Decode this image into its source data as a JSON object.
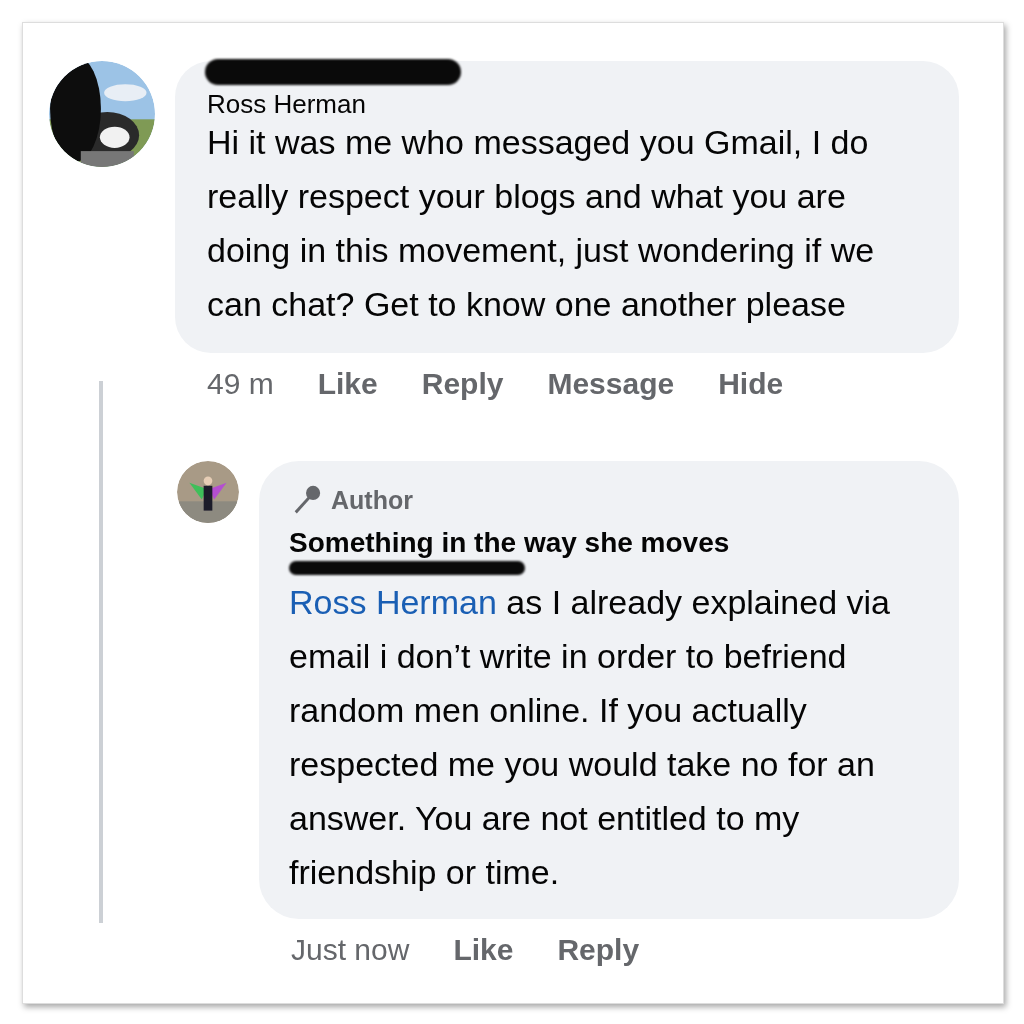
{
  "comments": [
    {
      "author": "Ross Herman",
      "redacted": true,
      "text": "Hi it was me who messaged you Gmail, I do really respect your blogs and what you are doing in this movement, just wondering if we can chat? Get to know one another please",
      "time": "49 m",
      "actions": [
        "Like",
        "Reply",
        "Message",
        "Hide"
      ],
      "replies": [
        {
          "badge": "Author",
          "author": "Something in the way she moves",
          "mention": "Ross Herman",
          "mention_redacted": true,
          "text": "as I already explained via email i don’t write in order to befriend random men online. If you actually respected me you would take no for an answer. You are not entitled to my friendship or time.",
          "time": "Just now",
          "actions": [
            "Like",
            "Reply"
          ]
        }
      ]
    }
  ]
}
